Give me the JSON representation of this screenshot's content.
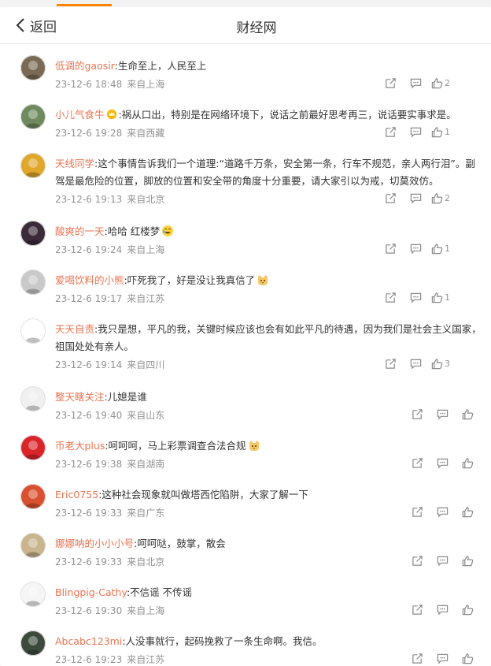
{
  "header": {
    "back_label": "返回",
    "title": "财经网"
  },
  "comments": [
    {
      "user": "低调的gaosir",
      "text": ":生命至上，人民至上",
      "time": "23-12-6 18:48",
      "location": "来自上海",
      "likes": "2",
      "avatar_color": "#7a6a55"
    },
    {
      "user": "小儿气食牛",
      "crown": true,
      "text": ":祸从口出，特别是在网络环境下，说话之前最好思考再三，说话要实事求是。",
      "time": "23-12-6 19:28",
      "location": "来自西藏",
      "likes": "1",
      "avatar_color": "#6f8a5e"
    },
    {
      "user": "天线同学",
      "text": ":这个事情告诉我们一个道理:“道路千万条，安全第一条，行车不规范，亲人两行泪”。副驾是最危险的位置，脚放的位置和安全带的角度十分重要，请大家引以为戒，切莫效仿。",
      "time": "23-12-6 19:13",
      "location": "来自北京",
      "likes": "2",
      "avatar_color": "#e0a72a"
    },
    {
      "user": "酸爽的一天",
      "text": ":哈哈 红楼梦",
      "emoji": "laugh",
      "time": "23-12-6 19:24",
      "location": "来自上海",
      "likes": "1",
      "avatar_color": "#3b2a3a"
    },
    {
      "user": "爱喝饮料的小熊",
      "text": ":吓死我了，好是没让我真信了",
      "emoji": "cat",
      "time": "23-12-6 19:17",
      "location": "来自江苏",
      "likes": "1",
      "avatar_color": "#c9c9c9"
    },
    {
      "user": "天天自责",
      "text": ":我只是想，平凡的我，关键时候应该也会有如此平凡的待遇，因为我们是社会主义国家，祖国处处有亲人。",
      "time": "23-12-6 19:14",
      "location": "来自四川",
      "likes": "3",
      "avatar_color": "#ffffff"
    },
    {
      "user": "整天瞎关注",
      "text": ":儿媳是谁",
      "time": "23-12-6 19:40",
      "location": "来自山东",
      "likes": "",
      "avatar_color": "#f0f0f0"
    },
    {
      "user": "币老大plus",
      "text": ":呵呵呵，马上彩票调查合法合规",
      "emoji": "cat",
      "time": "23-12-6 19:38",
      "location": "来自湖南",
      "likes": "",
      "avatar_color": "#d9242a"
    },
    {
      "user": "Eric0755",
      "text": ":这种社会现象就叫做塔西佗陷阱，大家了解一下",
      "time": "23-12-6 19:33",
      "location": "来自广东",
      "likes": "",
      "avatar_color": "#d8502f"
    },
    {
      "user": "娜娜呐的小小小号",
      "text": ":呵呵哒，鼓掌，散会",
      "time": "23-12-6 19:33",
      "location": "来自北京",
      "likes": "",
      "avatar_color": "#c9b48d"
    },
    {
      "user": "Blingpig-Cathy",
      "text": ":不信谣 不传谣",
      "time": "23-12-6 19:30",
      "location": "来自上海",
      "likes": "",
      "avatar_color": "#f5f5f5"
    },
    {
      "user": "Abcabc123mi",
      "text": ":人没事就行，起码挽救了一条生命啊。我信。",
      "time": "23-12-6 19:23",
      "location": "来自江苏",
      "likes": "",
      "avatar_color": "#3c4a3c"
    }
  ]
}
